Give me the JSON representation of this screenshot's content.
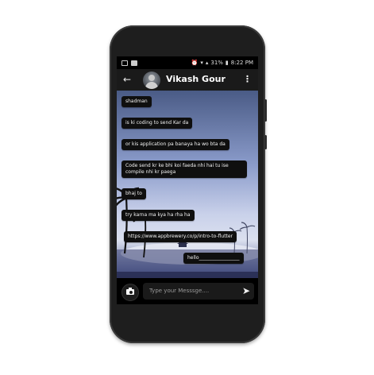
{
  "statusbar": {
    "battery": "31%",
    "time": "8:22 PM"
  },
  "appbar": {
    "back_icon": "arrow-back-icon",
    "contact_name": "Vikash Gour",
    "menu_icon": "more-vert-icon"
  },
  "messages": [
    {
      "text": "shadman"
    },
    {
      "text": "is ki coding to send Kar da"
    },
    {
      "text": "or kis application pa banaya ha wo bta da"
    },
    {
      "text": "Code send kr ke bhi koi faeda nhi hai tu ise compile nhi kr paega"
    },
    {
      "text": "bhaj to"
    },
    {
      "text": "try karna ma kya ha rha ha"
    },
    {
      "text": "https://www.appbrewery.co/p/intro-to-flutter"
    },
    {
      "text": "hello_________________"
    }
  ],
  "composer": {
    "placeholder": "Type your Messsge....",
    "camera_icon": "camera-icon",
    "send_icon": "send-icon"
  },
  "colors": {
    "bubble": "#0f0f0f",
    "appbar": "#1a1a1a"
  }
}
